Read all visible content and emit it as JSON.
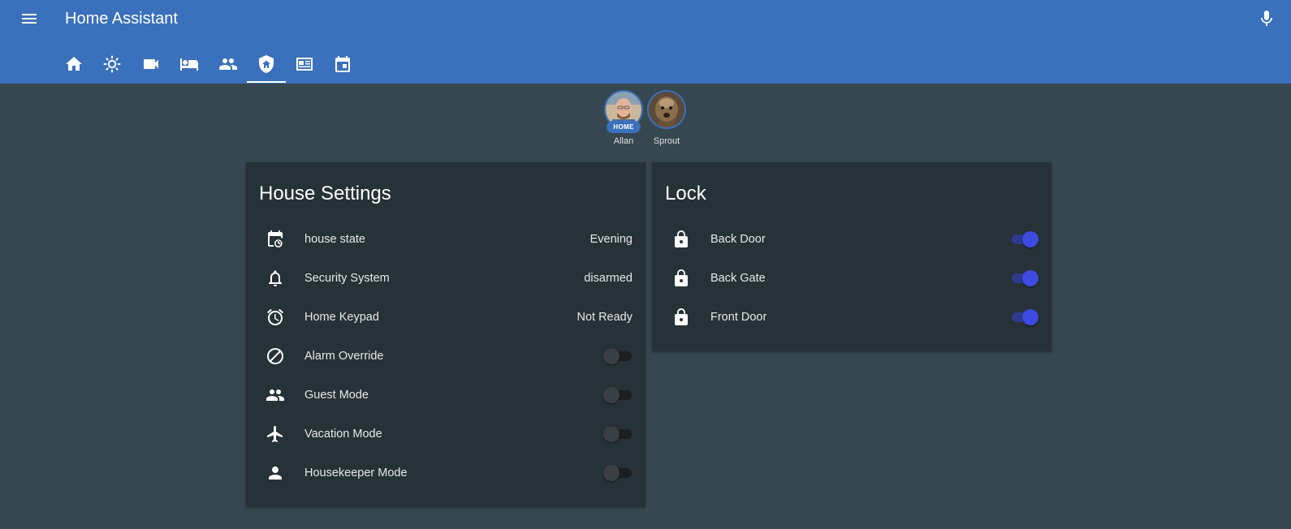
{
  "header": {
    "title": "Home Assistant"
  },
  "tabs": [
    {
      "icon": "home-icon"
    },
    {
      "icon": "brightness-icon"
    },
    {
      "icon": "video-camera-icon"
    },
    {
      "icon": "bed-icon"
    },
    {
      "icon": "people-icon"
    },
    {
      "icon": "shield-home-icon",
      "active": true
    },
    {
      "icon": "newspaper-icon"
    },
    {
      "icon": "calendar-icon"
    }
  ],
  "badges": [
    {
      "name": "Allan",
      "state": "HOME"
    },
    {
      "name": "Sprout"
    }
  ],
  "house_settings": {
    "title": "House Settings",
    "rows": [
      {
        "icon": "calendar-clock-icon",
        "label": "house state",
        "value": "Evening"
      },
      {
        "icon": "bell-icon",
        "label": "Security System",
        "value": "disarmed"
      },
      {
        "icon": "alarm-clock-icon",
        "label": "Home Keypad",
        "value": "Not Ready"
      },
      {
        "icon": "cancel-icon",
        "label": "Alarm Override",
        "toggle": false
      },
      {
        "icon": "people-icon",
        "label": "Guest Mode",
        "toggle": false
      },
      {
        "icon": "airplane-icon",
        "label": "Vacation Mode",
        "toggle": false
      },
      {
        "icon": "person-icon",
        "label": "Housekeeper Mode",
        "toggle": false
      }
    ]
  },
  "lock": {
    "title": "Lock",
    "rows": [
      {
        "icon": "lock-icon",
        "label": "Back Door",
        "toggle": true
      },
      {
        "icon": "lock-icon",
        "label": "Back Gate",
        "toggle": true
      },
      {
        "icon": "lock-icon",
        "label": "Front Door",
        "toggle": true
      }
    ]
  },
  "colors": {
    "header_bg": "#3b70bc",
    "page_bg": "#37474f",
    "card_bg": "#263238",
    "toggle_on": "#3d4be0"
  }
}
